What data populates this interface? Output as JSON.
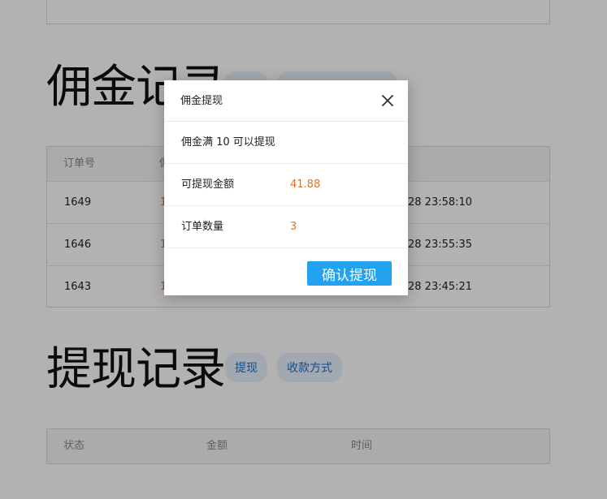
{
  "commission_section": {
    "title": "佣金记录",
    "table": {
      "headers": [
        "订单号",
        "佣"
      ],
      "rows": [
        {
          "order_no": "1649",
          "amount_partial": "1",
          "time_partial": "28 23:58:10"
        },
        {
          "order_no": "1646",
          "amount_partial": "1",
          "time_partial": "28 23:55:35"
        },
        {
          "order_no": "1643",
          "amount_partial": "1",
          "time_partial": "28 23:45:21"
        }
      ]
    }
  },
  "withdraw_section": {
    "title": "提现记录",
    "buttons": {
      "withdraw": "提现",
      "payment_method": "收款方式"
    },
    "table": {
      "headers": [
        "状态",
        "金额",
        "时间"
      ]
    }
  },
  "modal": {
    "title": "佣金提现",
    "threshold_text": "佣金满 10 可以提现",
    "rows": [
      {
        "label": "可提现金额",
        "value": "41.88"
      },
      {
        "label": "订单数量",
        "value": "3"
      }
    ],
    "confirm_label": "确认提现",
    "close_icon": "close-icon"
  },
  "colors": {
    "accent_blue": "#22a2f0",
    "value_orange": "#e8701d",
    "pill_bg": "#e8f1fb",
    "pill_text": "#1d6fd1",
    "overlay": "rgba(0,0,0,0.30)"
  }
}
